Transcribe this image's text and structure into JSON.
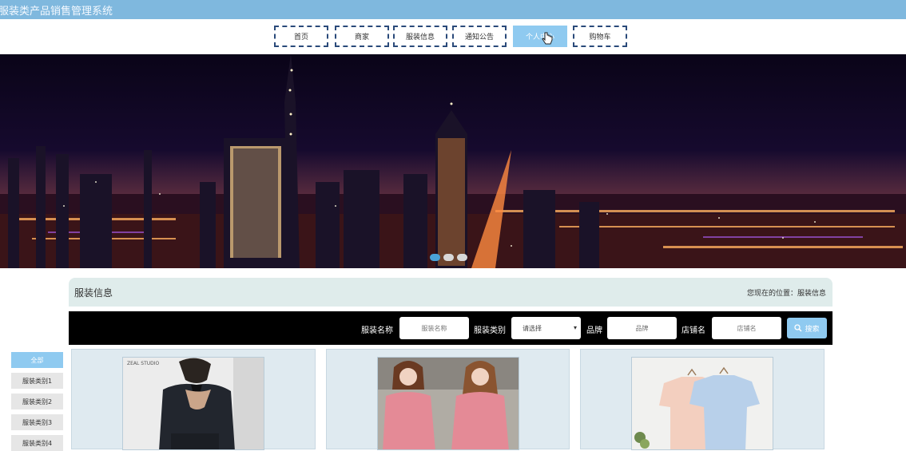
{
  "app": {
    "title": "服装类产品销售管理系统"
  },
  "nav": {
    "items": [
      {
        "label": "首页",
        "active": false
      },
      {
        "label": "商家",
        "active": false
      },
      {
        "label": "服装信息",
        "active": false
      },
      {
        "label": "通知公告",
        "active": false
      },
      {
        "label": "个人中心",
        "active": true
      },
      {
        "label": "购物车",
        "active": false
      }
    ]
  },
  "carousel": {
    "slide_count": 3,
    "active_index": 0
  },
  "section": {
    "title": "服装信息",
    "breadcrumb": "您现在的位置：服装信息"
  },
  "search": {
    "name_label": "服装名称",
    "name_placeholder": "服装名称",
    "category_label": "服装类别",
    "category_value": "请选择",
    "brand_label": "品牌",
    "brand_placeholder": "品牌",
    "shop_label": "店铺名",
    "shop_placeholder": "店铺名",
    "button_label": "搜索"
  },
  "categories": [
    {
      "label": "全部",
      "active": true
    },
    {
      "label": "服装类别1",
      "active": false
    },
    {
      "label": "服装类别2",
      "active": false
    },
    {
      "label": "服装类别3",
      "active": false
    },
    {
      "label": "服装类别4",
      "active": false
    }
  ],
  "products": [
    {
      "image_text": "ZEAL STUDIO"
    },
    {
      "image_text": ""
    },
    {
      "image_text": ""
    }
  ],
  "colors": {
    "accent": "#8fcaf0",
    "topbar": "#7fb8de",
    "nav_border": "#2a4a7a",
    "search_bg": "#000000"
  }
}
